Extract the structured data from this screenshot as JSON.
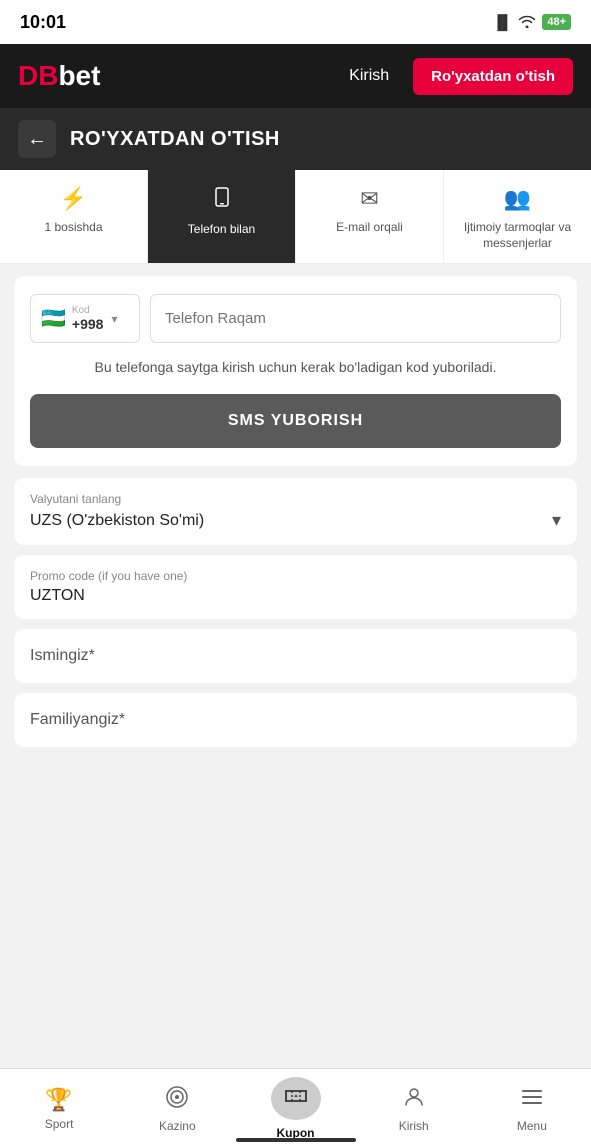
{
  "statusBar": {
    "time": "10:01",
    "battery": "48+",
    "batteryColor": "#4caf50"
  },
  "topNav": {
    "logo": {
      "db": "DB",
      "bet": "bet"
    },
    "kirish": "Kirish",
    "royxat": "Ro'yxatdan o'tish"
  },
  "pageHeader": {
    "title": "RO'YXATDAN O'TISH",
    "backArrow": "←"
  },
  "tabs": [
    {
      "id": "quick",
      "icon": "⚡",
      "label": "1 bosishda",
      "active": false
    },
    {
      "id": "phone",
      "icon": "📱",
      "label": "Telefon bilan",
      "active": true
    },
    {
      "id": "email",
      "icon": "✉",
      "label": "E-mail orqali",
      "active": false
    },
    {
      "id": "social",
      "icon": "👥",
      "label": "Ijtimoiy tarmoqlar va messenjerlar",
      "active": false
    }
  ],
  "form": {
    "country": {
      "label": "Kod",
      "code": "+998",
      "flag": "🇺🇿"
    },
    "phonePlaceholder": "Telefon Raqam",
    "infoText": "Bu telefonga saytga kirish uchun kerak bo'ladigan kod yuboriladi.",
    "smsButton": "SMS YUBORISH",
    "currency": {
      "label": "Valyutani tanlang",
      "value": "UZS  (O'zbekiston So'mi)"
    },
    "promo": {
      "label": "Promo code (if you have one)",
      "value": "UZTON"
    },
    "name": {
      "placeholder": "Ismingiz*"
    },
    "surname": {
      "placeholder": "Familiyangiz*"
    }
  },
  "bottomNav": [
    {
      "id": "sport",
      "icon": "🏆",
      "label": "Sport",
      "active": false
    },
    {
      "id": "kazino",
      "icon": "🎰",
      "label": "Kazino",
      "active": false
    },
    {
      "id": "kupon",
      "icon": "🎫",
      "label": "Kupon",
      "active": true
    },
    {
      "id": "kirish",
      "icon": "👤",
      "label": "Kirish",
      "active": false
    },
    {
      "id": "menu",
      "icon": "☰",
      "label": "Menu",
      "active": false
    }
  ]
}
